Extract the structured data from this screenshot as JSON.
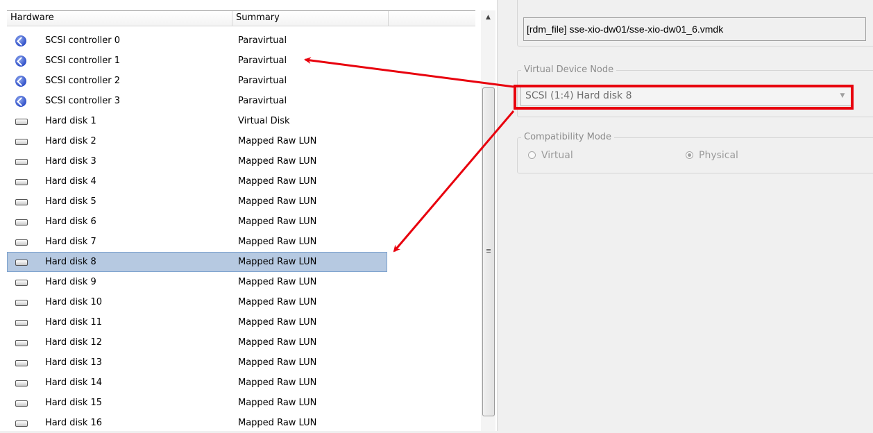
{
  "list": {
    "columns": [
      "Hardware",
      "Summary",
      ""
    ],
    "rows": [
      {
        "icon": "scsi-controller-icon",
        "name": "SCSI controller 0",
        "summary": "Paravirtual"
      },
      {
        "icon": "scsi-controller-icon",
        "name": "SCSI controller 1",
        "summary": "Paravirtual"
      },
      {
        "icon": "scsi-controller-icon",
        "name": "SCSI controller 2",
        "summary": "Paravirtual"
      },
      {
        "icon": "scsi-controller-icon",
        "name": "SCSI controller 3",
        "summary": "Paravirtual"
      },
      {
        "icon": "hard-disk-icon",
        "name": "Hard disk 1",
        "summary": "Virtual Disk"
      },
      {
        "icon": "hard-disk-icon",
        "name": "Hard disk 2",
        "summary": "Mapped Raw LUN"
      },
      {
        "icon": "hard-disk-icon",
        "name": "Hard disk 3",
        "summary": "Mapped Raw LUN"
      },
      {
        "icon": "hard-disk-icon",
        "name": "Hard disk 4",
        "summary": "Mapped Raw LUN"
      },
      {
        "icon": "hard-disk-icon",
        "name": "Hard disk 5",
        "summary": "Mapped Raw LUN"
      },
      {
        "icon": "hard-disk-icon",
        "name": "Hard disk 6",
        "summary": "Mapped Raw LUN"
      },
      {
        "icon": "hard-disk-icon",
        "name": "Hard disk 7",
        "summary": "Mapped Raw LUN"
      },
      {
        "icon": "hard-disk-icon",
        "name": "Hard disk 8",
        "summary": "Mapped Raw LUN",
        "selected": true
      },
      {
        "icon": "hard-disk-icon",
        "name": "Hard disk 9",
        "summary": "Mapped Raw LUN"
      },
      {
        "icon": "hard-disk-icon",
        "name": "Hard disk 10",
        "summary": "Mapped Raw LUN"
      },
      {
        "icon": "hard-disk-icon",
        "name": "Hard disk 11",
        "summary": "Mapped Raw LUN"
      },
      {
        "icon": "hard-disk-icon",
        "name": "Hard disk 12",
        "summary": "Mapped Raw LUN"
      },
      {
        "icon": "hard-disk-icon",
        "name": "Hard disk 13",
        "summary": "Mapped Raw LUN"
      },
      {
        "icon": "hard-disk-icon",
        "name": "Hard disk 14",
        "summary": "Mapped Raw LUN"
      },
      {
        "icon": "hard-disk-icon",
        "name": "Hard disk 15",
        "summary": "Mapped Raw LUN"
      },
      {
        "icon": "hard-disk-icon",
        "name": "Hard disk 16",
        "summary": "Mapped Raw LUN"
      }
    ]
  },
  "disk_file": {
    "value": "[rdm_file] sse-xio-dw01/sse-xio-dw01_6.vmdk"
  },
  "virtual_device_node": {
    "title": "Virtual Device Node",
    "selected": "SCSI (1:4) Hard disk 8"
  },
  "compatibility_mode": {
    "title": "Compatibility Mode",
    "options": [
      {
        "label": "Virtual",
        "checked": false
      },
      {
        "label": "Physical",
        "checked": true
      }
    ]
  },
  "annotation": {
    "color": "#e8000d"
  }
}
